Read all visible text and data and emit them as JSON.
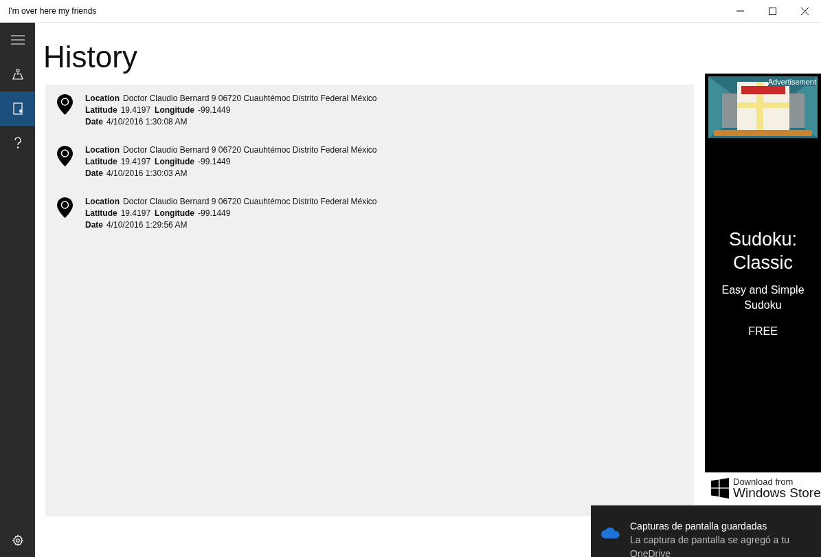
{
  "window": {
    "title": "I'm over here my friends"
  },
  "nav": [
    {
      "kind": "map",
      "selected": false
    },
    {
      "kind": "history",
      "selected": true
    },
    {
      "kind": "help",
      "selected": false
    }
  ],
  "page_title": "History",
  "entries": [
    {
      "location": {
        "label": "Location",
        "value": "Doctor Claudio Bernard 9 06720 Cuauhtémoc Distrito Federal México"
      },
      "latitude": {
        "label": "Latitude",
        "value": "19.4197"
      },
      "longitude": {
        "label": "Longitude",
        "value": "-99.1449"
      },
      "date": {
        "label": "Date",
        "value": "4/10/2016 1:30:08 AM"
      }
    },
    {
      "location": {
        "label": "Location",
        "value": "Doctor Claudio Bernard 9 06720 Cuauhtémoc Distrito Federal México"
      },
      "latitude": {
        "label": "Latitude",
        "value": "19.4197"
      },
      "longitude": {
        "label": "Longitude",
        "value": "-99.1449"
      },
      "date": {
        "label": "Date",
        "value": "4/10/2016 1:30:03 AM"
      }
    },
    {
      "location": {
        "label": "Location",
        "value": "Doctor Claudio Bernard 9 06720 Cuauhtémoc Distrito Federal México"
      },
      "latitude": {
        "label": "Latitude",
        "value": "19.4197"
      },
      "longitude": {
        "label": "Longitude",
        "value": "-99.1449"
      },
      "date": {
        "label": "Date",
        "value": "4/10/2016 1:29:56 AM"
      }
    }
  ],
  "ad": {
    "badge": "Advertisement",
    "title": "Sudoku: Classic",
    "subtitle": "Easy and Simple Sudoku",
    "price": "FREE",
    "store_line1": "Download from",
    "store_line2": "Windows Store"
  },
  "toast": {
    "title": "Capturas de pantalla guardadas",
    "body": "La captura de pantalla se agregó a tu OneDrive"
  }
}
